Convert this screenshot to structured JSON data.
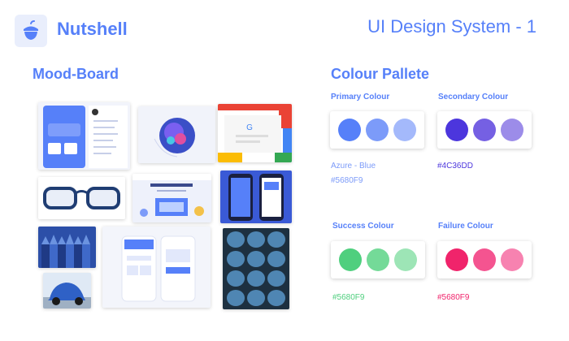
{
  "header": {
    "brand": "Nutshell",
    "logo_icon": "nut-icon",
    "title": "UI Design System - 1"
  },
  "moodboard": {
    "title": "Mood-Board",
    "tiles": [
      {
        "name": "dashboard-app-image"
      },
      {
        "name": "abstract-art-image"
      },
      {
        "name": "google-search-image"
      },
      {
        "name": "eyeglasses-image"
      },
      {
        "name": "landing-page-image"
      },
      {
        "name": "phone-mockup-image"
      },
      {
        "name": "blue-pencils-image"
      },
      {
        "name": "dashboard-phones-image"
      },
      {
        "name": "blue-eggs-image"
      },
      {
        "name": "beetle-car-image"
      }
    ]
  },
  "pallete": {
    "title": "Colour Pallete",
    "primary": {
      "label": "Primary Colour",
      "name": "Azure - Blue",
      "hex": "#5680F9",
      "dots": [
        "#5680F9",
        "#7c9bf9",
        "#a4b9fb"
      ]
    },
    "secondary": {
      "label": "Secondary Colour",
      "hex": "#4C36DD",
      "dots": [
        "#4C36DD",
        "#7560e3",
        "#9c8ce9"
      ]
    },
    "success": {
      "label": "Success Colour",
      "hex": "#5680F9",
      "dots": [
        "#4fcf7e",
        "#74da98",
        "#9de5b6"
      ]
    },
    "failure": {
      "label": "Failure Colour",
      "hex": "#5680F9",
      "dots": [
        "#f0246b",
        "#f45490",
        "#f782b0"
      ]
    }
  },
  "colors": {
    "accent": "#5680F9",
    "secondary_text": "#4C36DD",
    "success_text": "#4fcf7e",
    "failure_text": "#f0246b"
  }
}
